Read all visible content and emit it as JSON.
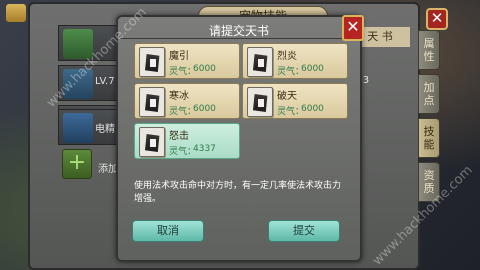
{
  "outer_panel": {
    "title": "宠物技能",
    "close_label": "✕",
    "right_tabs": [
      "属性",
      "加点",
      "技能",
      "资质"
    ],
    "strip_label": "天  书",
    "strip_value": "333",
    "left_items": [
      {
        "text": ""
      },
      {
        "text": "LV.7"
      },
      {
        "text": ""
      },
      {
        "text": "电精"
      }
    ],
    "add_label": "添加",
    "add_icon": "+"
  },
  "dialog": {
    "title": "请提交天书",
    "close_label": "✕",
    "books": [
      {
        "name": "魔引",
        "lingqi_label": "灵气：",
        "lingqi_value": "6000"
      },
      {
        "name": "烈炎",
        "lingqi_label": "灵气：",
        "lingqi_value": "6000"
      },
      {
        "name": "寒冰",
        "lingqi_label": "灵气：",
        "lingqi_value": "6000"
      },
      {
        "name": "破天",
        "lingqi_label": "灵气：",
        "lingqi_value": "6000"
      },
      {
        "name": "怒击",
        "lingqi_label": "灵气：",
        "lingqi_value": "4337",
        "selected": true
      }
    ],
    "description": "使用法术攻击命中对方时，有一定几率使法术攻击力增强。",
    "cancel_label": "取消",
    "submit_label": "提交"
  },
  "watermark": "www.hackhome.com",
  "colors": {
    "accent": "#5fb9a7",
    "close_red": "#b52420",
    "card_bg": "#e4d6b0",
    "selected_bg": "#b6e3cf"
  }
}
